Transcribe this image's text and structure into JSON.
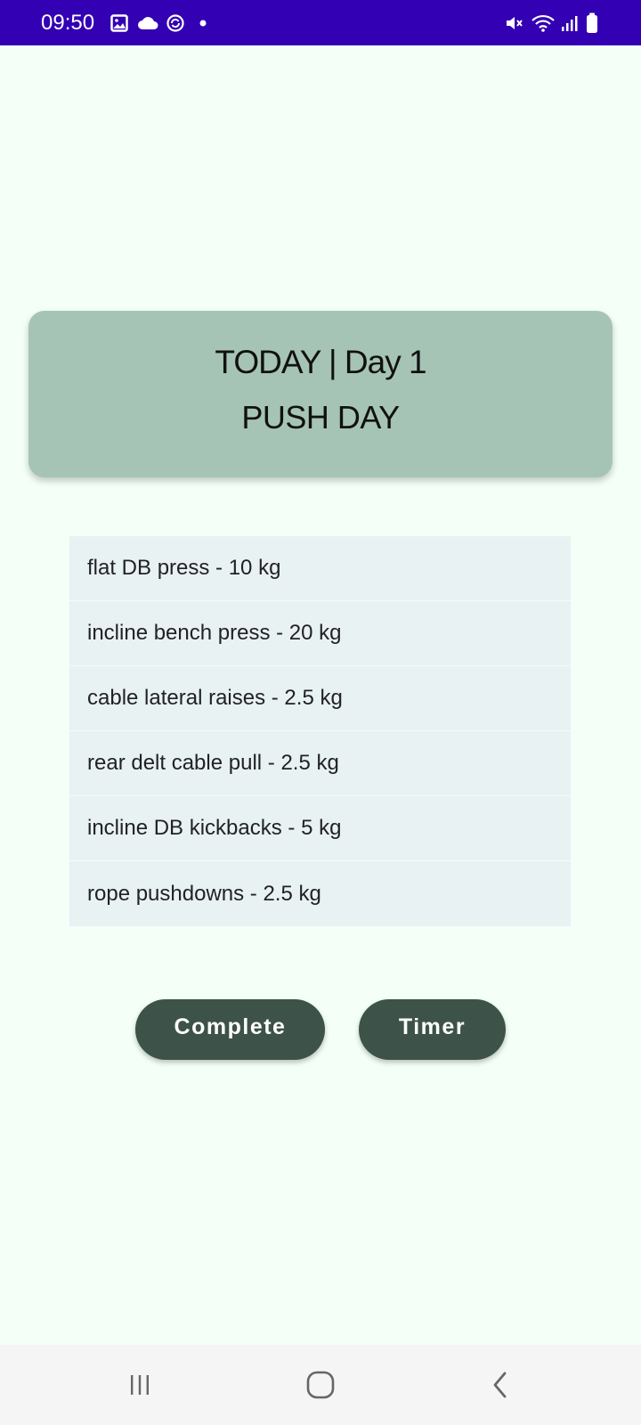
{
  "status_bar": {
    "time": "09:50",
    "icons": [
      "image-icon",
      "cloud-icon",
      "sync-icon",
      "dot-icon",
      "mute-icon",
      "wifi-icon",
      "signal-icon",
      "battery-icon"
    ]
  },
  "header": {
    "line1": "TODAY | Day 1",
    "line2": "PUSH DAY"
  },
  "exercises": [
    "flat DB press - 10 kg",
    "incline bench press - 20 kg",
    "cable lateral raises - 2.5 kg",
    "rear delt cable pull - 2.5 kg",
    "incline DB kickbacks - 5 kg",
    "rope pushdowns - 2.5 kg"
  ],
  "buttons": {
    "complete": "Complete",
    "timer": "Timer"
  },
  "nav": {
    "icons": [
      "recents-icon",
      "home-icon",
      "back-icon"
    ]
  },
  "colors": {
    "status_bar": "#3300b3",
    "background": "#f3fff7",
    "header_card": "#a5c4b5",
    "list_bg": "#e8f2f3",
    "button": "#3d5249"
  }
}
